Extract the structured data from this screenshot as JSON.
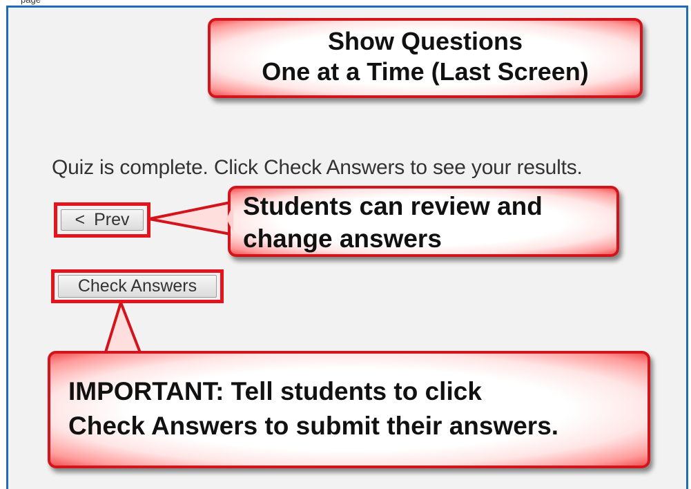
{
  "page_fragment_text": "page",
  "callouts": {
    "title": {
      "line1": "Show Questions",
      "line2": "One at a Time (Last Screen)"
    },
    "review": {
      "line1": "Students can review and",
      "line2": "change answers"
    },
    "important": {
      "line1": "IMPORTANT: Tell students to click",
      "line2": "Check Answers to submit their answers."
    }
  },
  "quiz": {
    "status_text": "Quiz is complete. Click Check Answers to see your results.",
    "prev_chevron": "<",
    "prev_label": "Prev",
    "check_answers_label": "Check Answers"
  },
  "colors": {
    "frame_border": "#1e6bb8",
    "callout_border": "#d2151d",
    "highlight_border": "#e3141c",
    "background": "#f2f2f2"
  }
}
